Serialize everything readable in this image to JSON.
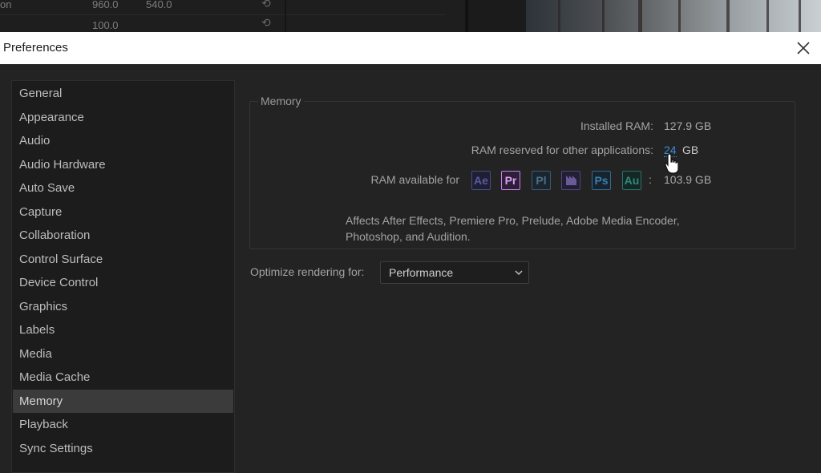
{
  "background": {
    "rows": [
      {
        "label": "on",
        "val1": "960.0",
        "val2": "540.0"
      },
      {
        "label": "",
        "val1": "100.0",
        "val2": ""
      }
    ]
  },
  "dialog": {
    "title": "Preferences"
  },
  "sidebar": {
    "items": [
      {
        "label": "General"
      },
      {
        "label": "Appearance"
      },
      {
        "label": "Audio"
      },
      {
        "label": "Audio Hardware"
      },
      {
        "label": "Auto Save"
      },
      {
        "label": "Capture"
      },
      {
        "label": "Collaboration"
      },
      {
        "label": "Control Surface"
      },
      {
        "label": "Device Control"
      },
      {
        "label": "Graphics"
      },
      {
        "label": "Labels"
      },
      {
        "label": "Media"
      },
      {
        "label": "Media Cache"
      },
      {
        "label": "Memory"
      },
      {
        "label": "Playback"
      },
      {
        "label": "Sync Settings"
      }
    ],
    "selected": "Memory"
  },
  "memory": {
    "group_label": "Memory",
    "installed_ram_label": "Installed RAM:",
    "installed_ram_value": "127.9 GB",
    "reserved_label": "RAM reserved for other applications:",
    "reserved_value": "24",
    "reserved_unit": "GB",
    "available_label": "RAM available for",
    "available_value": "103.9 GB",
    "colon": ":",
    "apps": [
      {
        "abbr": "Ae",
        "color": "#6b6bb8"
      },
      {
        "abbr": "Pr",
        "color": "#c97ee6"
      },
      {
        "abbr": "Pl",
        "color": "#4a6f8a"
      },
      {
        "abbr": "Me",
        "color": "#6a5a9a"
      },
      {
        "abbr": "Ps",
        "color": "#3b7fa6"
      },
      {
        "abbr": "Au",
        "color": "#2f8a7a"
      }
    ],
    "description": "Affects After Effects, Premiere Pro, Prelude, Adobe Media Encoder, Photoshop, and Audition."
  },
  "rendering": {
    "label": "Optimize rendering for:",
    "value": "Performance"
  }
}
